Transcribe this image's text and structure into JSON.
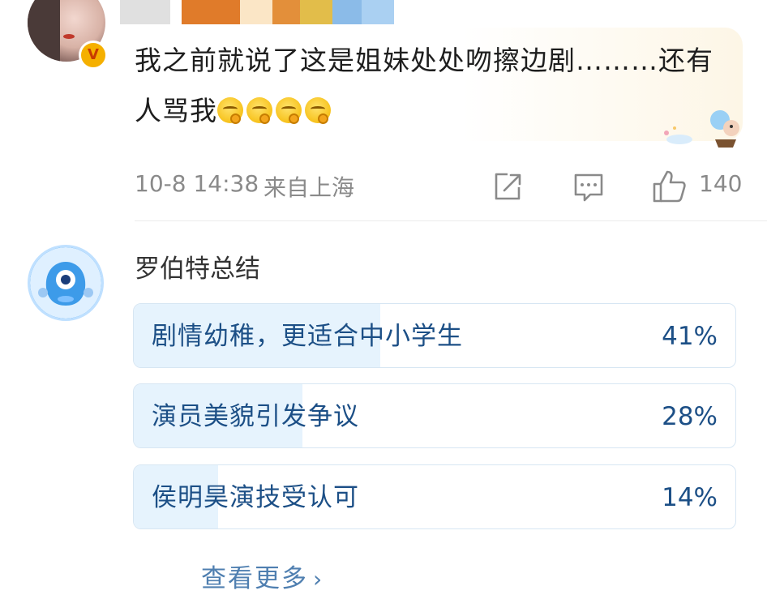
{
  "comment1": {
    "text": "我之前就说了这是姐妹处处吻擦边剧………还有人骂我",
    "emojis": [
      "thinking-emoji",
      "thinking-emoji",
      "thinking-emoji",
      "thinking-emoji"
    ],
    "badge": "V",
    "time": "10-8 14:38",
    "location": "来自上海",
    "like_count": "140",
    "icons": [
      "share-icon",
      "comment-icon",
      "like-icon"
    ]
  },
  "poll": {
    "title": "罗伯特总结",
    "options": [
      {
        "label": "剧情幼稚，更适合中小学生",
        "percent": "41%",
        "fraction": 0.41
      },
      {
        "label": "演员美貌引发争议",
        "percent": "28%",
        "fraction": 0.28
      },
      {
        "label": "侯明昊演技受认可",
        "percent": "14%",
        "fraction": 0.14
      }
    ],
    "see_more": "查看更多",
    "see_more_icon": "chevron-right-icon"
  },
  "colors": {
    "poll_fill": "#e6f3fd",
    "poll_text": "#1c4f86",
    "link": "#4f7fb0",
    "meta": "#8a8a8a",
    "verified_badge": "#f5b000"
  }
}
